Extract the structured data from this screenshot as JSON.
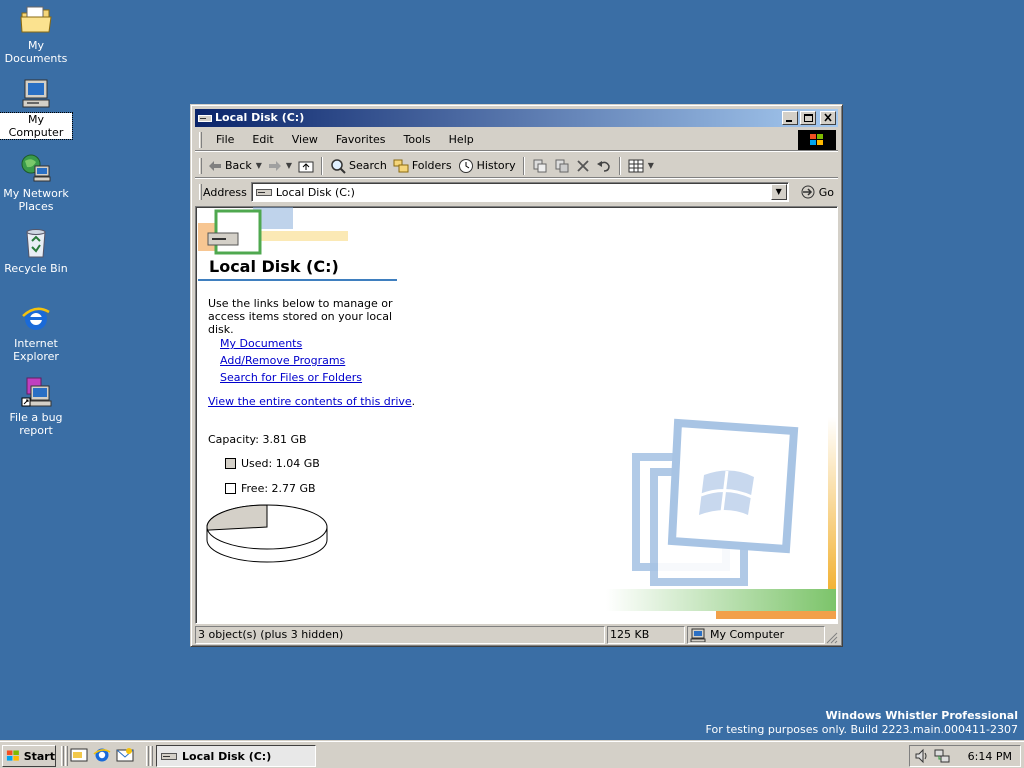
{
  "desktop": {
    "background": "#3a6ea5",
    "icons": [
      {
        "label": "My Documents",
        "icon": "my-documents-icon"
      },
      {
        "label": "My Computer",
        "icon": "my-computer-icon"
      },
      {
        "label": "My Network Places",
        "icon": "network-places-icon"
      },
      {
        "label": "Recycle Bin",
        "icon": "recycle-bin-icon"
      },
      {
        "label": "Internet Explorer",
        "icon": "internet-explorer-icon"
      },
      {
        "label": "File a bug report",
        "icon": "bug-report-icon"
      }
    ]
  },
  "window": {
    "title": "Local Disk (C:)",
    "menu": [
      "File",
      "Edit",
      "View",
      "Favorites",
      "Tools",
      "Help"
    ],
    "toolbar": {
      "back": "Back",
      "search": "Search",
      "folders": "Folders",
      "history": "History"
    },
    "address": {
      "label": "Address",
      "value": "Local Disk (C:)",
      "go": "Go"
    },
    "content": {
      "title": "Local Disk (C:)",
      "intro": "Use the links below to manage or access items stored on your local disk.",
      "links": [
        "My Documents",
        "Add/Remove Programs",
        "Search for Files or Folders"
      ],
      "view_contents": "View the entire contents of this drive",
      "view_contents_suffix": ".",
      "capacity": "Capacity: 3.81 GB",
      "used": "Used: 1.04 GB",
      "free": "Free: 2.77 GB",
      "used_fraction": 0.273,
      "used_color": "#d4d0c8",
      "free_color": "#ffffff"
    },
    "status": {
      "objects": "3 object(s) (plus 3 hidden)",
      "size": "125 KB",
      "location": "My Computer"
    }
  },
  "os_watermark": {
    "name": "Windows Whistler Professional",
    "build": "For testing purposes only. Build 2223.main.000411-2307"
  },
  "taskbar": {
    "start": "Start",
    "task": "Local Disk (C:)",
    "clock": "6:14 PM"
  }
}
